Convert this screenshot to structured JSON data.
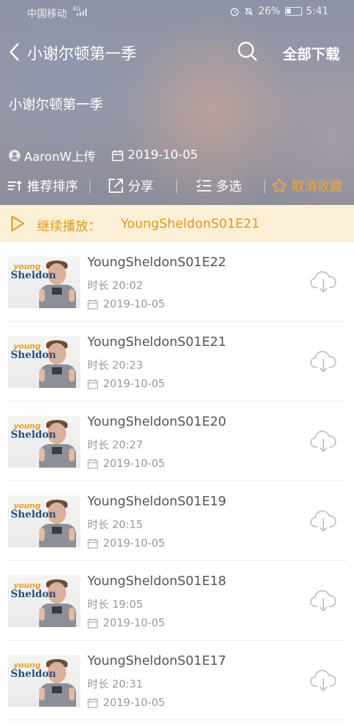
{
  "status_bar": {
    "carrier": "中国移动",
    "network": "4G",
    "battery": "26%",
    "time": "5:41"
  },
  "nav": {
    "title": "小谢尔顿第一季",
    "download_all": "全部下载"
  },
  "header": {
    "subtitle": "小谢尔顿第一季",
    "uploader": "AaronW上传",
    "date": "2019-10-05"
  },
  "actions": {
    "sort": "推荐排序",
    "share": "分享",
    "multi_select": "多选",
    "unfavorite": "取消收藏"
  },
  "continue_play": {
    "label": "继续播放：",
    "episode": "YoungSheldonS01E21"
  },
  "thumbnail": {
    "logo_top": "young",
    "logo_bottom": "Sheldon"
  },
  "episodes": [
    {
      "title": "YoungSheldonS01E22",
      "duration": "时长 20:02",
      "date": "2019-10-05"
    },
    {
      "title": "YoungSheldonS01E21",
      "duration": "时长 20:23",
      "date": "2019-10-05"
    },
    {
      "title": "YoungSheldonS01E20",
      "duration": "时长 20:27",
      "date": "2019-10-05"
    },
    {
      "title": "YoungSheldonS01E19",
      "duration": "时长 20:15",
      "date": "2019-10-05"
    },
    {
      "title": "YoungSheldonS01E18",
      "duration": "时长 19:05",
      "date": "2019-10-05"
    },
    {
      "title": "YoungSheldonS01E17",
      "duration": "时长 20:31",
      "date": "2019-10-05"
    }
  ],
  "colors": {
    "accent_orange": "#e09a1e",
    "continue_bg": "#fbefd6",
    "icon_gray": "#c2c2c2"
  }
}
